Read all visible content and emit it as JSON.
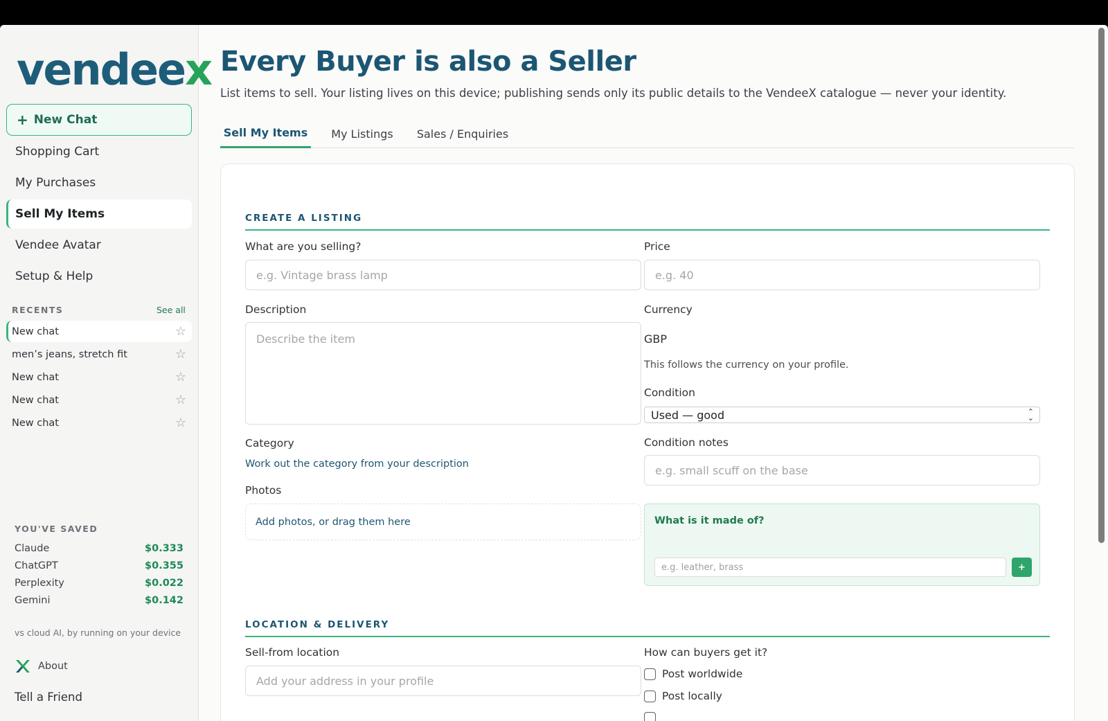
{
  "brand": {
    "logo_main": "vendee",
    "logo_x": "x"
  },
  "sidebar": {
    "new_chat": "New Chat",
    "nav": [
      {
        "label": "Shopping Cart"
      },
      {
        "label": "My Purchases"
      },
      {
        "label": "Sell My Items",
        "active": true
      },
      {
        "label": "Vendee Avatar"
      },
      {
        "label": "Setup & Help"
      }
    ],
    "recents_title": "RECENTS",
    "see_all": "See all",
    "recents": [
      {
        "label": "New chat",
        "active": true
      },
      {
        "label": "men’s jeans, stretch fit"
      },
      {
        "label": "New chat"
      },
      {
        "label": "New chat"
      },
      {
        "label": "New chat"
      }
    ],
    "saved_title": "YOU'VE SAVED",
    "saved": [
      {
        "name": "Claude",
        "amount": "$0.333"
      },
      {
        "name": "ChatGPT",
        "amount": "$0.355"
      },
      {
        "name": "Perplexity",
        "amount": "$0.022"
      },
      {
        "name": "Gemini",
        "amount": "$0.142"
      }
    ],
    "saved_note": "vs cloud AI, by running on your device",
    "about": "About",
    "tell_friend": "Tell a Friend"
  },
  "main": {
    "title": "Every Buyer is also a Seller",
    "subtitle": "List items to sell. Your listing lives on this device; publishing sends only its public details to the VendeeX catalogue — never your identity.",
    "tabs": [
      {
        "label": "Sell My Items",
        "active": true
      },
      {
        "label": "My Listings"
      },
      {
        "label": "Sales / Enquiries"
      }
    ],
    "create": {
      "heading": "CREATE A LISTING",
      "selling_label": "What are you selling?",
      "selling_placeholder": "e.g. Vintage brass lamp",
      "price_label": "Price",
      "price_placeholder": "e.g. 40",
      "description_label": "Description",
      "description_placeholder": "Describe the item",
      "currency_label": "Currency",
      "currency_value": "GBP",
      "currency_hint": "This follows the currency on your profile.",
      "condition_label": "Condition",
      "condition_value": "Used — good",
      "condition_notes_label": "Condition notes",
      "condition_notes_placeholder": "e.g. small scuff on the base",
      "category_label": "Category",
      "category_link": "Work out the category from your description",
      "photos_label": "Photos",
      "photos_drop": "Add photos, or drag them here",
      "material_question": "What is it made of?",
      "material_placeholder": "e.g. leather, brass",
      "material_add": "+"
    },
    "location": {
      "heading": "LOCATION & DELIVERY",
      "sell_from_label": "Sell-from location",
      "sell_from_placeholder": "Add your address in your profile",
      "delivery_label": "How can buyers get it?",
      "options": [
        {
          "label": "Post worldwide"
        },
        {
          "label": "Post locally"
        }
      ]
    }
  },
  "colors": {
    "brand_blue": "#1c5673",
    "brand_green": "#2fa56c"
  }
}
